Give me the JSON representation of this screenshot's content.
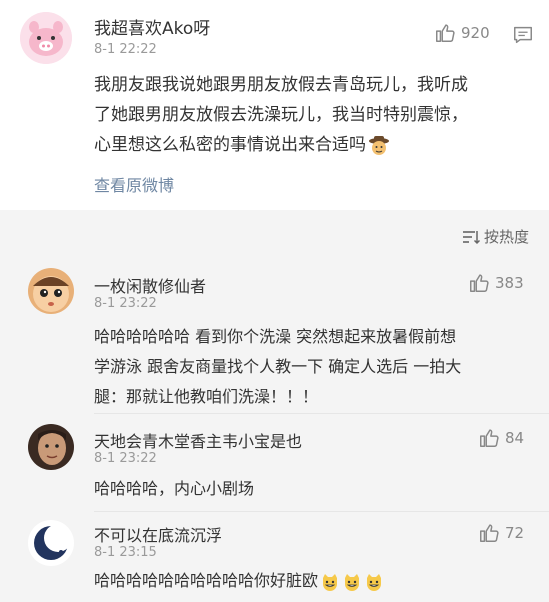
{
  "post": {
    "username": "我超喜欢Ako呀",
    "time": "8-1 22:22",
    "likes": "920",
    "text_lines": [
      "我朋友跟我说她跟男朋友放假去青岛玩儿，我听成",
      "了她跟男朋友放假去洗澡玩儿，我当时特别震惊，",
      "心里想这么私密的事情说出来合适吗"
    ],
    "origin_link": "查看原微博"
  },
  "sort_label": "按热度",
  "comments": [
    {
      "username": "一枚闲散修仙者",
      "time": "8-1 23:22",
      "likes": "383",
      "text_lines": [
        "哈哈哈哈哈哈 看到你个洗澡 突然想起来放暑假前想",
        "学游泳 跟舍友商量找个人教一下 确定人选后 一拍大",
        "腿：那就让他教咱们洗澡！！！"
      ]
    },
    {
      "username": "天地会青木堂香主韦小宝是也",
      "time": "8-1 23:22",
      "likes": "84",
      "text_lines": [
        "哈哈哈哈，内心小剧场"
      ]
    },
    {
      "username": "不可以在底流沉浮",
      "time": "8-1 23:15",
      "likes": "72",
      "text_lines": [
        "哈哈哈哈哈哈哈哈哈哈你好脏欧"
      ]
    }
  ],
  "icons": {
    "like": "thumbs-up-icon",
    "comment": "comment-icon",
    "sort": "sort-icon",
    "emoji_cowboy": "cowboy-emoji",
    "emoji_cat": "cat-grin-emoji"
  },
  "colors": {
    "link": "#6f87a3",
    "meta": "#9a9a9a"
  }
}
